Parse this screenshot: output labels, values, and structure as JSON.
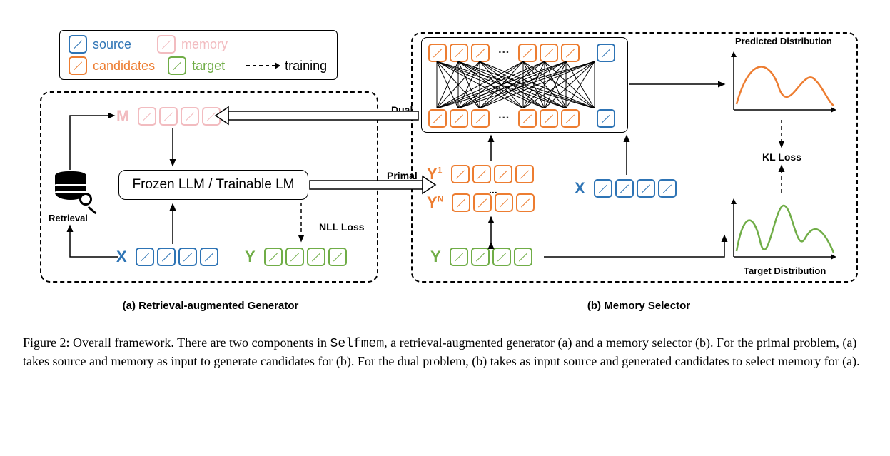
{
  "legend": {
    "source": "source",
    "memory": "memory",
    "candidates": "candidates",
    "target": "target",
    "training": "training"
  },
  "seq_labels": {
    "M": "M",
    "X": "X",
    "Y": "Y",
    "Y1_pre": "Y",
    "Y1_sup": "1",
    "YN_pre": "Y",
    "YN_sup": "N",
    "X2": "X",
    "Y2": "Y"
  },
  "lm_box": "Frozen LLM / Trainable LM",
  "retrieval": "Retrieval",
  "labels": {
    "nll": "NLL Loss",
    "primal": "Primal",
    "dual": "Dual",
    "kl": "KL Loss",
    "pred_dist": "Predicted Distribution",
    "targ_dist": "Target Distribution",
    "candidate_dots": "..."
  },
  "panel_titles": {
    "a": "(a) Retrieval-augmented Generator",
    "b": "(b) Memory Selector"
  },
  "caption": {
    "prefix": "Figure 2: Overall framework. There are two components in ",
    "code": "Selfmem",
    "rest": ", a retrieval-augmented generator (a) and a memory selector (b). For the primal problem, (a) takes source and memory as input to generate candidates for (b). For the dual problem, (b) takes as input source and generated candidates to select memory for (a)."
  }
}
